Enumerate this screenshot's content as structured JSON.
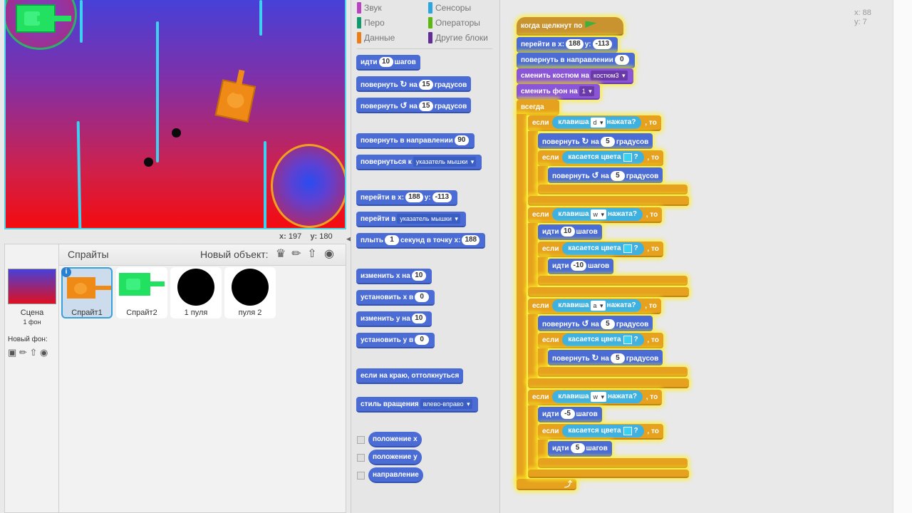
{
  "stage": {
    "mouse_x_label": "x:",
    "mouse_x": "197",
    "mouse_y_label": "y:",
    "mouse_y": "180"
  },
  "sprites_panel": {
    "title": "Спрайты",
    "new_sprite_label": "Новый объект:",
    "stage_label": "Сцена",
    "stage_backdrops": "1 фон",
    "new_backdrop_label": "Новый фон:",
    "sprites": [
      {
        "name": "Спрайт1",
        "selected": true
      },
      {
        "name": "Спрайт2",
        "selected": false
      },
      {
        "name": "1 пуля",
        "selected": false
      },
      {
        "name": "пуля 2",
        "selected": false
      }
    ]
  },
  "palette": {
    "categories": [
      {
        "label": "Звук",
        "color": "#bb42c3"
      },
      {
        "label": "Сенсоры",
        "color": "#2ca5e2"
      },
      {
        "label": "Перо",
        "color": "#0e9a6c"
      },
      {
        "label": "Операторы",
        "color": "#5cb712"
      },
      {
        "label": "Данные",
        "color": "#ee7d16"
      },
      {
        "label": "Другие блоки",
        "color": "#632d99"
      }
    ],
    "blocks": {
      "move": {
        "label": "идти",
        "value": "10",
        "suffix": "шагов"
      },
      "turn_right": {
        "label": "повернуть",
        "mid": "на",
        "value": "15",
        "suffix": "градусов"
      },
      "turn_left": {
        "label": "повернуть",
        "mid": "на",
        "value": "15",
        "suffix": "градусов"
      },
      "point_dir": {
        "label": "повернуть в направлении",
        "value": "90"
      },
      "point_towards": {
        "label": "повернуться к",
        "value": "указатель мышки"
      },
      "goto_xy": {
        "label": "перейти в x:",
        "x": "188",
        "ylabel": "y:",
        "y": "-113"
      },
      "goto": {
        "label": "перейти в",
        "value": "указатель мышки"
      },
      "glide": {
        "label": "плыть",
        "value": "1",
        "mid": "секунд в точку x:",
        "x": "188"
      },
      "change_x": {
        "label": "изменить х на",
        "value": "10"
      },
      "set_x": {
        "label": "установить х в",
        "value": "0"
      },
      "change_y": {
        "label": "изменить у на",
        "value": "10"
      },
      "set_y": {
        "label": "установить у в",
        "value": "0"
      },
      "bounce": {
        "label": "если на краю, оттолкнуться"
      },
      "rotation_style": {
        "label": "стиль вращения",
        "value": "влево-вправо"
      },
      "reporter_x": {
        "label": "положение x"
      },
      "reporter_y": {
        "label": "положение y"
      },
      "reporter_dir": {
        "label": "направление"
      }
    }
  },
  "script": {
    "mouse_xy": {
      "x_label": "x:",
      "x": "88",
      "y_label": "y:",
      "y": "7"
    },
    "hat": "когда щелкнут по",
    "goto_label": "перейти в x:",
    "goto_x": "188",
    "goto_ylabel": "y:",
    "goto_y": "-113",
    "point_label": "повернуть в направлении",
    "point_value": "0",
    "costume_label": "сменить костюм на",
    "costume_value": "костюм3",
    "backdrop_label": "сменить фон на",
    "backdrop_value": "1",
    "forever": "всегда",
    "if": "если",
    "then": ", то",
    "key_label": "клавиша",
    "pressed": "нажата?",
    "touch_color": "касается цвета",
    "q": "?",
    "turn": "повернуть",
    "on": "на",
    "degrees": "градусов",
    "go": "идти",
    "steps": "шагов",
    "sections": [
      {
        "key": "d",
        "turn_val": "5",
        "inner_val": "5"
      },
      {
        "key": "w",
        "move_val": "10",
        "inner_val": "-10"
      },
      {
        "key": "a",
        "turn_val": "5",
        "inner_val": "5"
      },
      {
        "key": "w",
        "move_val": "-5",
        "inner_val": "5"
      }
    ]
  }
}
